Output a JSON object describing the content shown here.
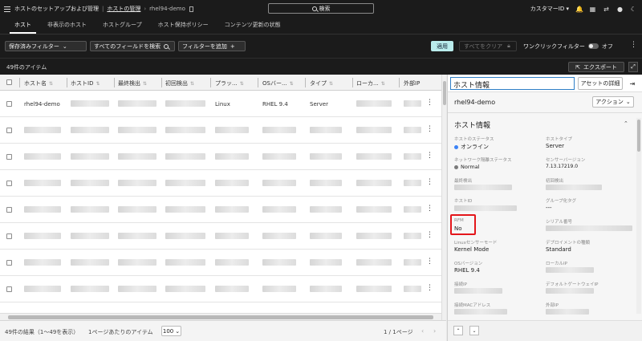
{
  "topbar": {
    "breadcrumb_root": "ホストのセットアップおよび管理",
    "breadcrumb_link": "ホストの管理",
    "breadcrumb_current": "rhel94-demo",
    "search_label": "検索",
    "customer_id_label": "カスタマーID",
    "icons": [
      "menu-icon",
      "bookmark-icon",
      "bell-icon",
      "grid-icon",
      "switch-icon",
      "user-icon",
      "moon-icon"
    ]
  },
  "nav": {
    "tabs": [
      {
        "label": "ホスト",
        "active": true
      },
      {
        "label": "非表示のホスト",
        "active": false
      },
      {
        "label": "ホストグループ",
        "active": false
      },
      {
        "label": "ホスト保持ポリシー",
        "active": false
      },
      {
        "label": "コンテンツ更新の状態",
        "active": false
      }
    ]
  },
  "filters": {
    "saved_filters": "保存済みフィルター",
    "search_fields": "すべてのフィールドを検索",
    "add_filter": "フィルターを追加",
    "apply": "適用",
    "clear_all": "すべてをクリア",
    "one_click": "ワンクリックフィルター",
    "one_click_state": "オフ"
  },
  "results": {
    "count_label": "49件のアイテム",
    "export_label": "エクスポート"
  },
  "table": {
    "columns": [
      "ホスト名",
      "ホストID",
      "最終検出",
      "初回検出",
      "プラッ...",
      "OSバー...",
      "タイプ",
      "ローカ...",
      "外部IP"
    ],
    "first_row": {
      "hostname": "rhel94-demo",
      "platform": "Linux",
      "os_version": "RHEL 9.4",
      "type": "Server"
    }
  },
  "footer": {
    "results_text": "49件の結果（1〜49を表示）",
    "per_page_label": "1ページあたりのアイテム",
    "per_page_value": "100",
    "page_text": "1 / 1ページ"
  },
  "detail": {
    "panel_title": "ホスト情報",
    "asset_details_button": "アセットの詳細",
    "hostname": "rhel94-demo",
    "action_button": "アクション",
    "section_title": "ホスト情報",
    "fields": {
      "host_status_label": "ホストのステータス",
      "host_status_value": "オンライン",
      "host_type_label": "ホストタイプ",
      "host_type_value": "Server",
      "network_label": "ネットワーク隔離ステータス",
      "network_value": "Normal",
      "sensor_version_label": "センサーバージョン",
      "sensor_version_value": "7.13.17219.0",
      "last_seen_label": "最終検出",
      "first_seen_label": "初回検出",
      "host_id_label": "ホストID",
      "group_tag_label": "グループ化タグ",
      "group_tag_value": "---",
      "rfm_label": "RFM",
      "rfm_value": "No",
      "serial_label": "シリアル番号",
      "linux_mode_label": "Linuxセンサーモード",
      "linux_mode_value": "Kernel Mode",
      "deployment_label": "デプロイメントの種類",
      "deployment_value": "Standard",
      "os_version_label": "OSバージョン",
      "os_version_value": "RHEL 9.4",
      "local_ip_label": "ローカルIP",
      "connect_ip_label": "接続IP",
      "gateway_label": "デフォルトゲートウェイIP",
      "mac_label": "接続MACアドレス",
      "external_ip_label": "外部IP"
    }
  },
  "colors": {
    "online": "#3b82f6",
    "normal": "#7a7a7a",
    "apply_bg": "#b9ecec",
    "highlight": "#e4161b"
  }
}
